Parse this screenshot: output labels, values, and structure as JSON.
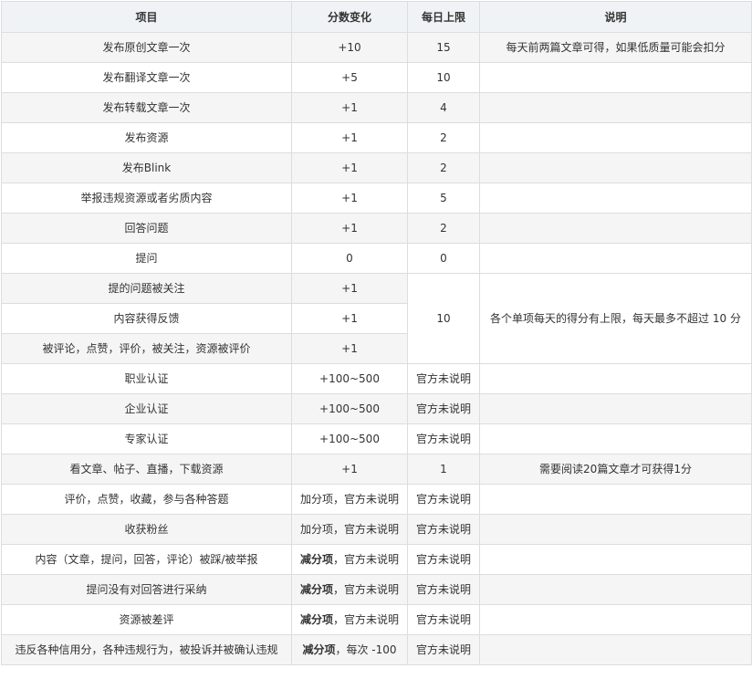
{
  "headers": [
    "项目",
    "分数变化",
    "每日上限",
    "说明"
  ],
  "rows": [
    {
      "item": "发布原创文章一次",
      "score": "+10",
      "limit": "15",
      "note": "每天前两篇文章可得，如果低质量可能会扣分"
    },
    {
      "item": "发布翻译文章一次",
      "score": "+5",
      "limit": "10",
      "note": ""
    },
    {
      "item": "发布转载文章一次",
      "score": "+1",
      "limit": "4",
      "note": ""
    },
    {
      "item": "发布资源",
      "score": "+1",
      "limit": "2",
      "note": ""
    },
    {
      "item": "发布Blink",
      "score": "+1",
      "limit": "2",
      "note": ""
    },
    {
      "item": "举报违规资源或者劣质内容",
      "score": "+1",
      "limit": "5",
      "note": ""
    },
    {
      "item": "回答问题",
      "score": "+1",
      "limit": "2",
      "note": ""
    },
    {
      "item": "提问",
      "score": "0",
      "limit": "0",
      "note": ""
    },
    {
      "item": "提的问题被关注",
      "score": "+1"
    },
    {
      "item": "内容获得反馈",
      "score": "+1"
    },
    {
      "item": "被评论，点赞，评价，被关注，资源被评价",
      "score": "+1"
    },
    {
      "item": "职业认证",
      "score": "+100~500",
      "limit": "官方未说明",
      "note": ""
    },
    {
      "item": "企业认证",
      "score": "+100~500",
      "limit": "官方未说明",
      "note": ""
    },
    {
      "item": "专家认证",
      "score": "+100~500",
      "limit": "官方未说明",
      "note": ""
    },
    {
      "item": "看文章、帖子、直播，下载资源",
      "score": "+1",
      "limit": "1",
      "note": "需要阅读20篇文章才可获得1分"
    },
    {
      "item": "评价，点赞，收藏，参与各种答题",
      "score": "加分项，官方未说明",
      "limit": "官方未说明",
      "note": ""
    },
    {
      "item": "收获粉丝",
      "score": "加分项，官方未说明",
      "limit": "官方未说明",
      "note": ""
    },
    {
      "item": "内容（文章，提问，回答，评论）被踩/被举报",
      "score_bold": "减分项",
      "score_rest": "，官方未说明",
      "limit": "官方未说明",
      "note": ""
    },
    {
      "item": "提问没有对回答进行采纳",
      "score_bold": "减分项",
      "score_rest": "，官方未说明",
      "limit": "官方未说明",
      "note": ""
    },
    {
      "item": "资源被差评",
      "score_bold": "减分项",
      "score_rest": "，官方未说明",
      "limit": "官方未说明",
      "note": ""
    },
    {
      "item": "违反各种信用分，各种违规行为，被投诉并被确认违规",
      "score_bold": "减分项",
      "score_rest": "，每次 -100",
      "limit": "官方未说明",
      "note": ""
    }
  ],
  "merged": {
    "limit": "10",
    "note": "各个单项每天的得分有上限，每天最多不超过 10 分"
  }
}
